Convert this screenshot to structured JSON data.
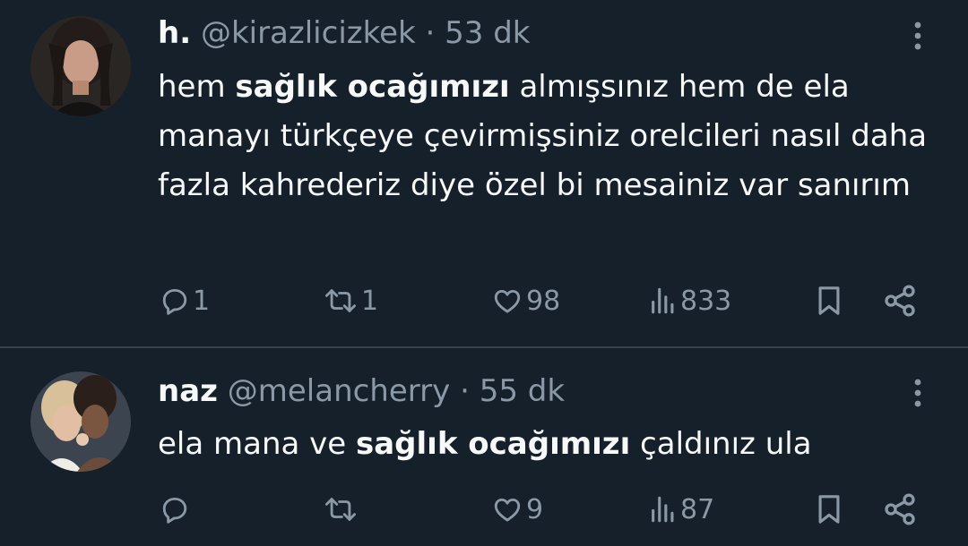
{
  "colors": {
    "background": "#15202b",
    "text": "#f7f9f9",
    "secondary_text": "#8b98a5",
    "divider": "#38444d"
  },
  "tweets": [
    {
      "display_name": "h.",
      "handle": "@kirazlicizkek",
      "separator": "·",
      "time": "53 dk",
      "body": [
        {
          "text": "hem ",
          "bold": false
        },
        {
          "text": "sağlık ocağımızı",
          "bold": true
        },
        {
          "text": " almışsınız hem de ela manayı türkçeye çevirmişsiniz orelcileri nasıl daha fazla kahrederiz diye özel bi mesainiz var sanırım",
          "bold": false
        }
      ],
      "actions": {
        "replies": "1",
        "reposts": "1",
        "likes": "98",
        "views": "833"
      },
      "icons": [
        "avatar",
        "more-icon",
        "reply-icon",
        "repost-icon",
        "like-icon",
        "views-icon",
        "bookmark-icon",
        "share-icon"
      ]
    },
    {
      "display_name": "naz",
      "handle": "@melancherry",
      "separator": "·",
      "time": "55 dk",
      "body": [
        {
          "text": "ela mana ve ",
          "bold": false
        },
        {
          "text": "sağlık ocağımızı",
          "bold": true
        },
        {
          "text": " çaldınız ula",
          "bold": false
        }
      ],
      "actions": {
        "replies": "",
        "reposts": "",
        "likes": "9",
        "views": "87"
      },
      "icons": [
        "avatar",
        "more-icon",
        "reply-icon",
        "repost-icon",
        "like-icon",
        "views-icon",
        "bookmark-icon",
        "share-icon"
      ]
    }
  ]
}
